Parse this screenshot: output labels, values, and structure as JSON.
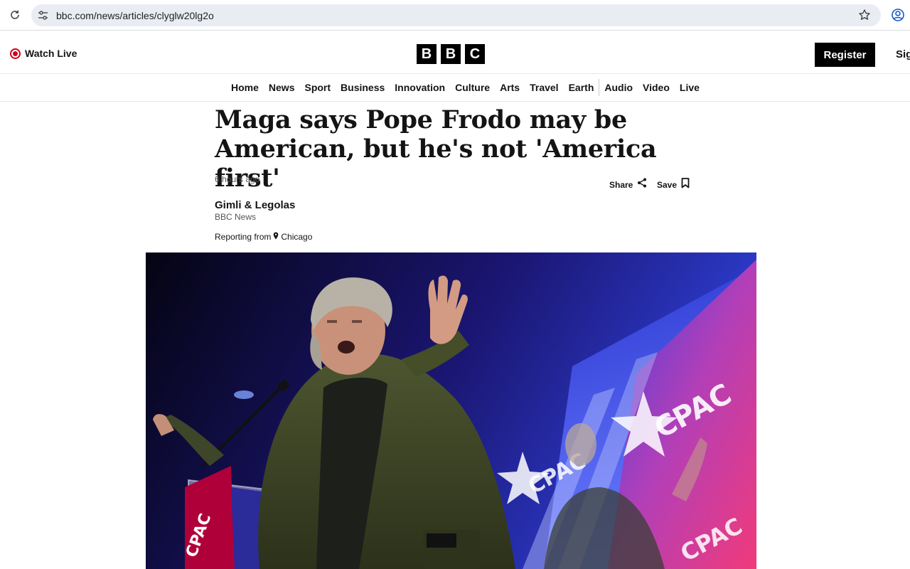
{
  "browser": {
    "url": "bbc.com/news/articles/clyglw20lg2o"
  },
  "header": {
    "watch_live": "Watch Live",
    "logo_letters": [
      "B",
      "B",
      "C"
    ],
    "register": "Register",
    "sign_in": "Sign In"
  },
  "nav": {
    "items": [
      "Home",
      "News",
      "Sport",
      "Business",
      "Innovation",
      "Culture",
      "Arts",
      "Travel",
      "Earth",
      "Audio",
      "Video",
      "Live"
    ]
  },
  "article": {
    "headline": "Maga says Pope Frodo may be American, but he's not 'America first'",
    "timestamp": "6 hours ago",
    "share_label": "Share",
    "save_label": "Save",
    "author": "Gimli & Legolas",
    "author_org": "BBC News",
    "reporting_label": "Reporting from",
    "reporting_location": "Chicago"
  },
  "photo": {
    "signage_text": "CPAC"
  },
  "colors": {
    "live_red": "#d4001a",
    "brand_black": "#000000",
    "omnibox_bg": "#e9edf3"
  }
}
